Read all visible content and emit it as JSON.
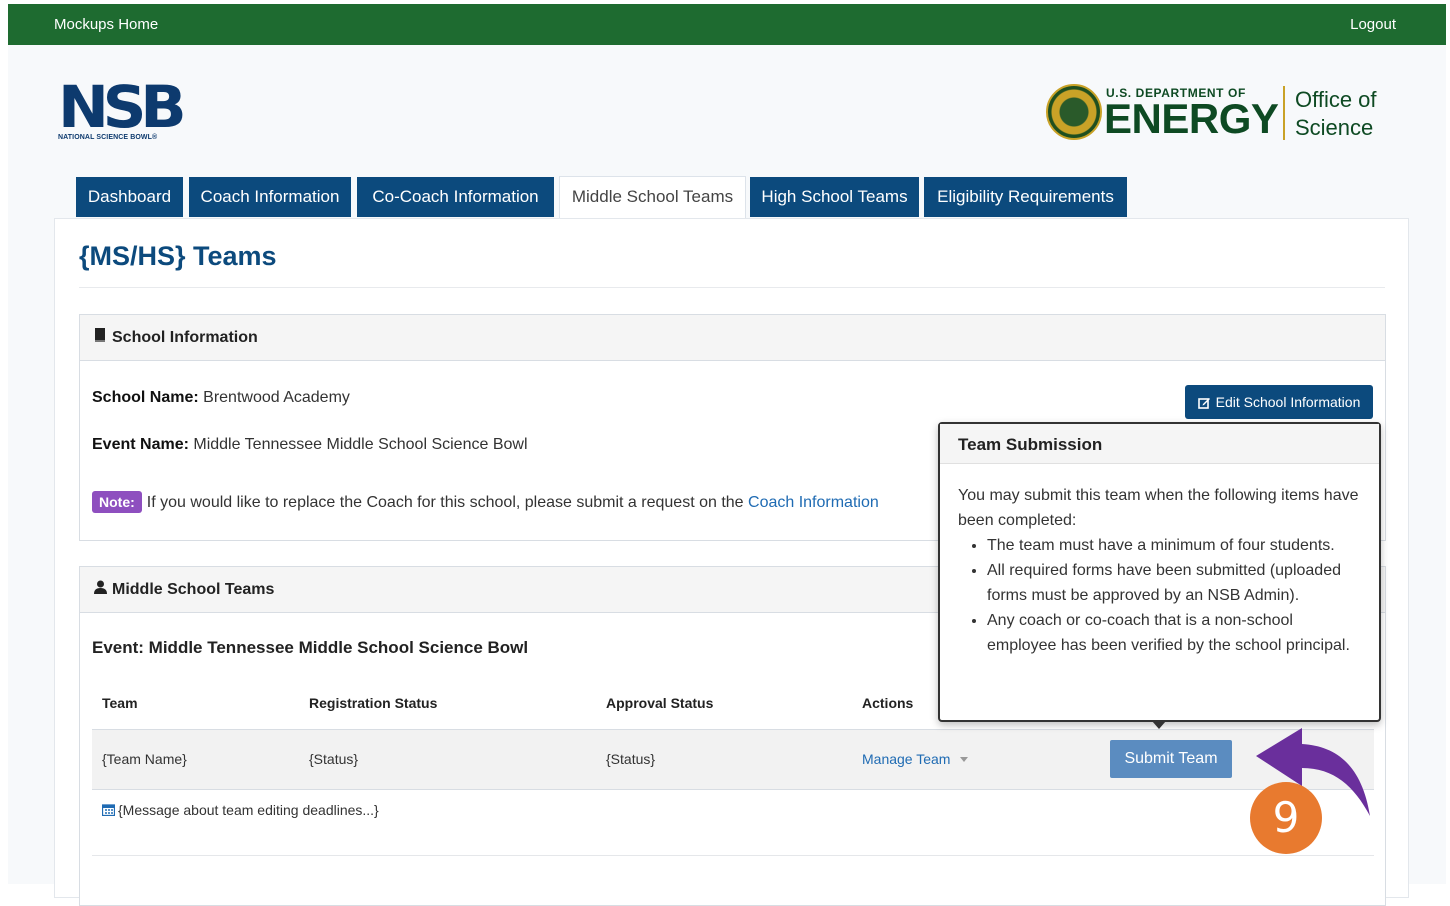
{
  "topbar": {
    "home_label": "Mockups Home",
    "logout_label": "Logout"
  },
  "logos": {
    "nsb_letters": "NSB",
    "nsb_subtitle": "NATIONAL SCIENCE BOWL®",
    "doe_top": "U.S. DEPARTMENT OF",
    "doe_energy": "ENERGY",
    "doe_office_1": "Office of",
    "doe_office_2": "Science"
  },
  "tabs": [
    {
      "label": "Dashboard"
    },
    {
      "label": "Coach Information"
    },
    {
      "label": "Co-Coach Information"
    },
    {
      "label": "Middle School Teams",
      "active": true
    },
    {
      "label": "High School Teams"
    },
    {
      "label": "Eligibility Requirements"
    }
  ],
  "page_title": "{MS/HS} Teams",
  "school_card": {
    "heading": "School Information",
    "school_name_label": "School Name:",
    "school_name_value": "Brentwood Academy",
    "event_name_label": "Event Name:",
    "event_name_value": "Middle Tennessee Middle School Science Bowl",
    "note_badge": "Note:",
    "note_text": "If you would like to replace the Coach for this school, please submit a request on the",
    "note_link": "Coach Information",
    "edit_button": "Edit School Information"
  },
  "teams_card": {
    "heading": "Middle School Teams",
    "event_line": "Event: Middle Tennessee Middle School Science Bowl",
    "columns": [
      "Team",
      "Registration Status",
      "Approval Status",
      "Actions"
    ],
    "rows": [
      {
        "team": "{Team Name}",
        "registration": "{Status}",
        "approval": "{Status}",
        "action": "Manage Team",
        "submit": "Submit Team"
      }
    ],
    "message": "{Message about team editing deadlines...}"
  },
  "popover": {
    "title": "Team Submission",
    "intro": "You may submit this team when the following items have been completed:",
    "items": [
      "The team must have a minimum of four students.",
      "All required forms have been submitted (uploaded forms must be approved by an NSB Admin).",
      "Any coach or co-coach that is a non-school employee has been verified by the school principal."
    ]
  },
  "step_marker": "9",
  "colors": {
    "topbar": "#1e6b30",
    "tab": "#0c4a7d",
    "note": "#8e4fbf",
    "submit": "#5b8cc0",
    "step_badge": "#e87a2f",
    "step_arrow": "#6a2f9c"
  }
}
